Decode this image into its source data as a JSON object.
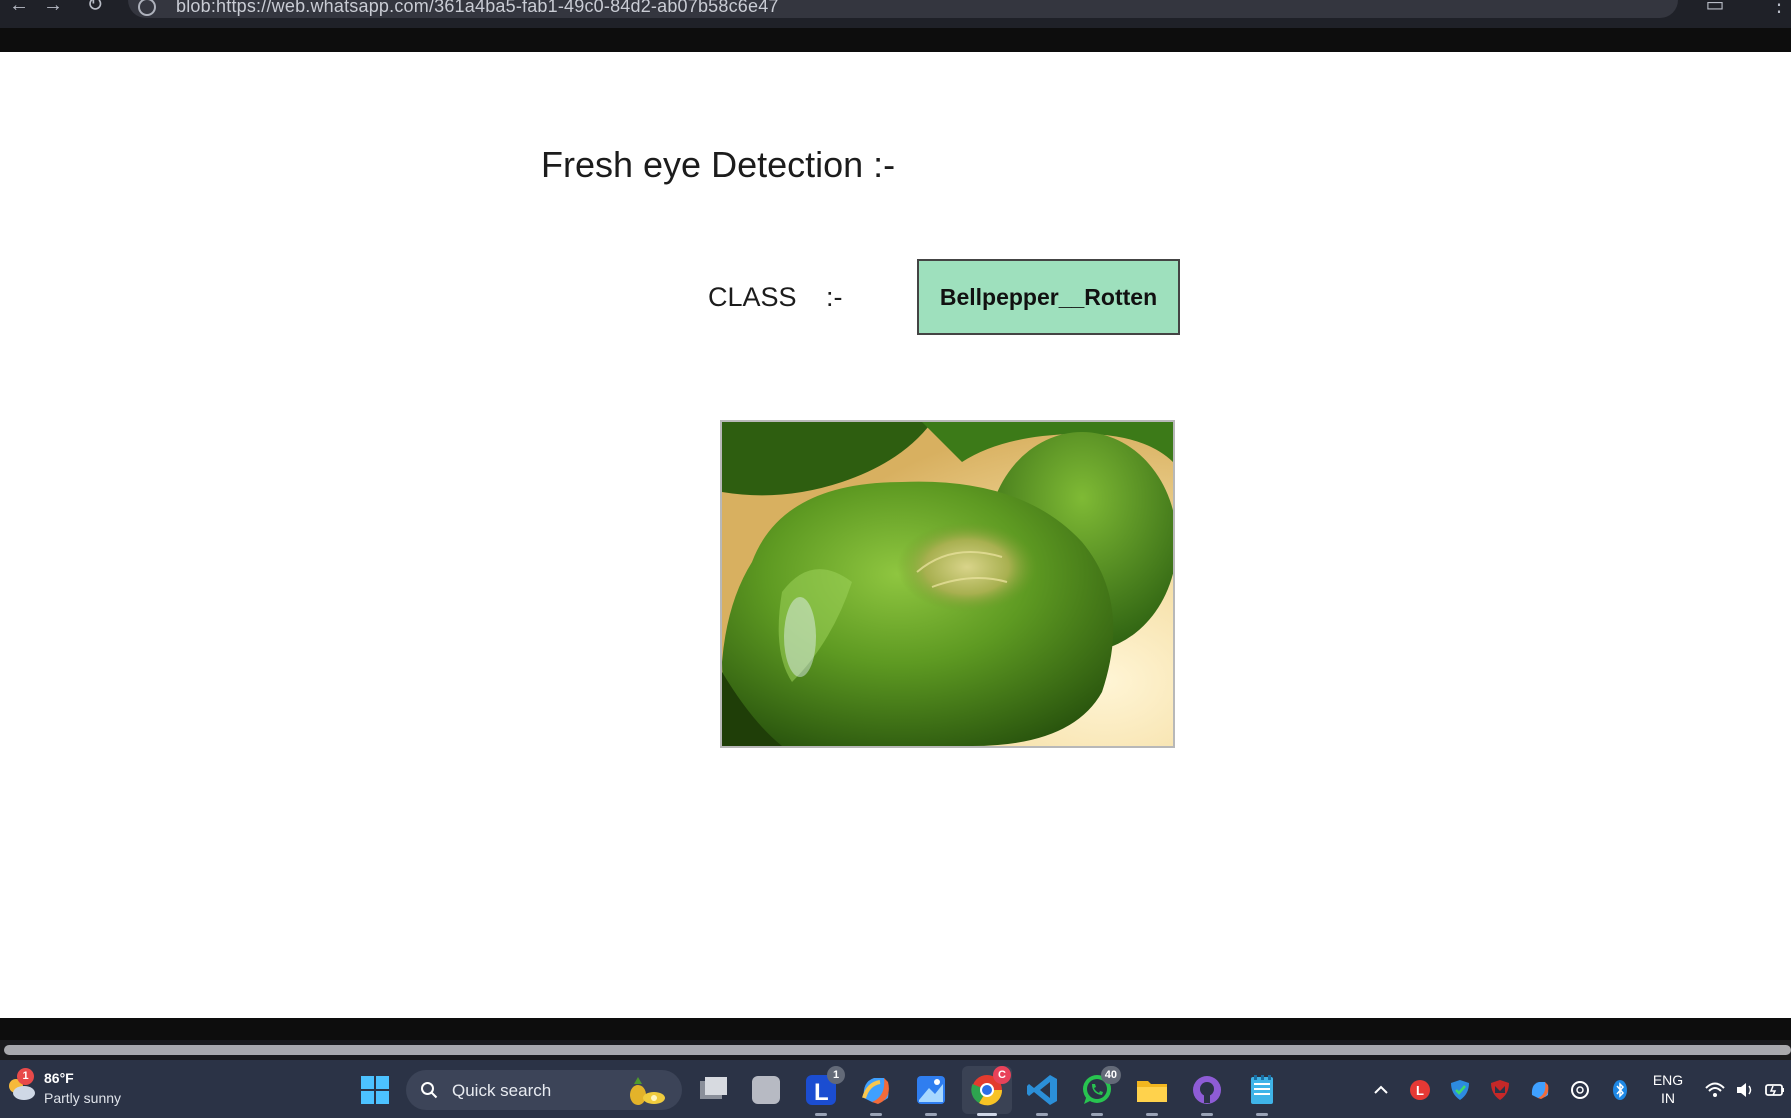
{
  "browser": {
    "address": "blob:https://web.whatsapp.com/361a4ba5-fab1-49c0-84d2-ab07b58c6e47"
  },
  "page": {
    "title": "Fresh eye Detection :-",
    "class_label": "CLASS",
    "class_separator": ":-",
    "class_value": "Bellpepper__Rotten",
    "class_box_color": "#9ee0bd",
    "image_subject": "green bell pepper with rotten patch"
  },
  "taskbar": {
    "weather": {
      "badge": "1",
      "temp": "86°F",
      "desc": "Partly sunny"
    },
    "search_placeholder": "Quick search",
    "apps": [
      {
        "name": "task-view-icon"
      },
      {
        "name": "app-grey-icon"
      },
      {
        "name": "l-app-icon",
        "badge": "1"
      },
      {
        "name": "copilot-icon"
      },
      {
        "name": "photos-icon"
      },
      {
        "name": "chrome-icon",
        "badge": "C"
      },
      {
        "name": "vscode-icon"
      },
      {
        "name": "whatsapp-icon",
        "badge": "40"
      },
      {
        "name": "file-explorer-icon"
      },
      {
        "name": "github-icon"
      },
      {
        "name": "notepad-icon"
      }
    ],
    "language": {
      "line1": "ENG",
      "line2": "IN"
    }
  }
}
